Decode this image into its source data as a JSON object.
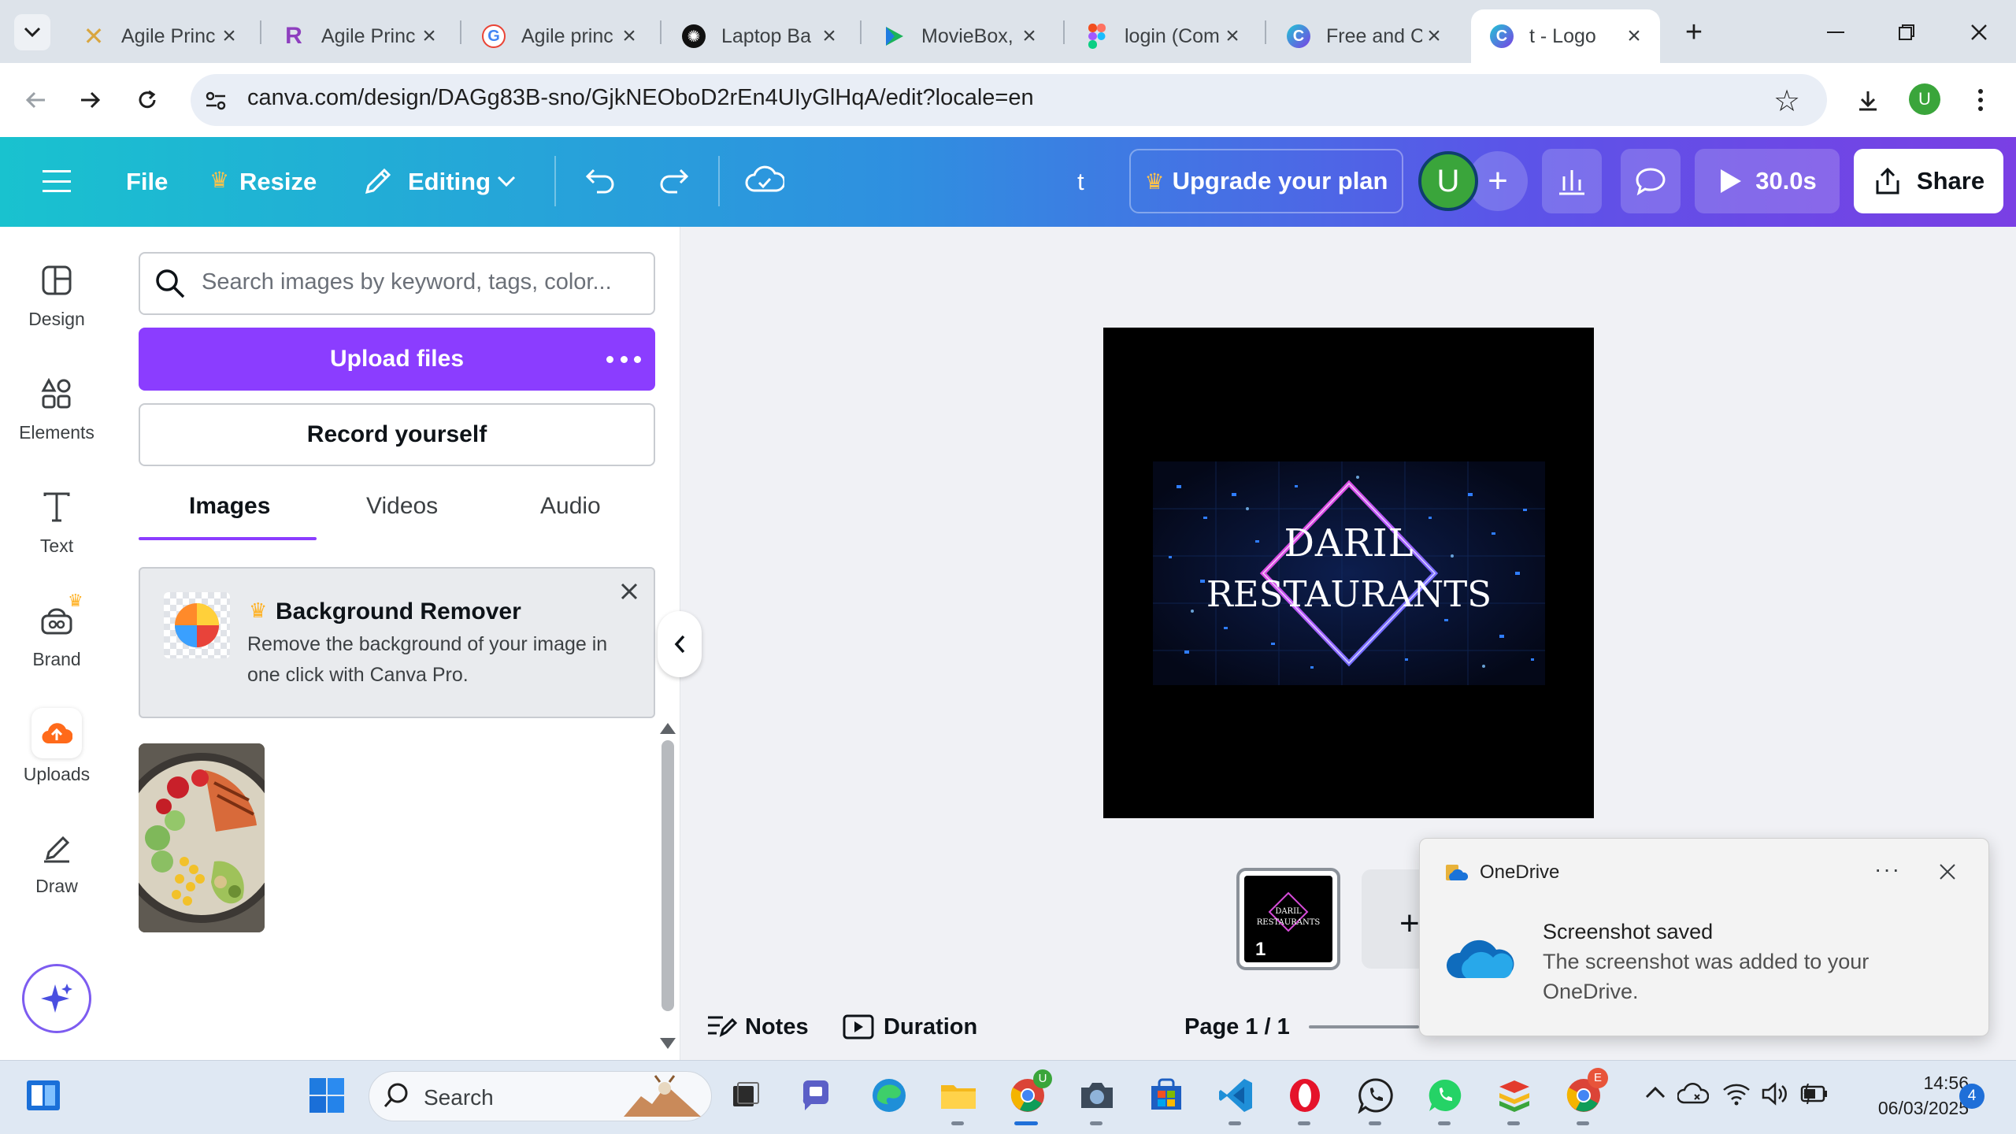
{
  "browser": {
    "tabs": [
      {
        "label": "Agile Princ",
        "icon": "agile-x-icon"
      },
      {
        "label": "Agile Princ",
        "icon": "agile-r-icon"
      },
      {
        "label": "Agile princ",
        "icon": "google-icon"
      },
      {
        "label": "Laptop Ba",
        "icon": "openai-icon"
      },
      {
        "label": "MovieBox,",
        "icon": "moviebox-icon"
      },
      {
        "label": "login (Com",
        "icon": "figma-icon"
      },
      {
        "label": "Free and C",
        "icon": "canva-icon"
      },
      {
        "label": "t - Logo",
        "icon": "canva-icon",
        "active": true
      }
    ],
    "url": "canva.com/design/DAGg83B-sno/GjkNEOboD2rEn4UIyGlHqA/edit?locale=en",
    "profile_initial": "U"
  },
  "header": {
    "file": "File",
    "resize": "Resize",
    "editing": "Editing",
    "design_title": "t",
    "upgrade": "Upgrade your plan",
    "avatar_initial": "U",
    "timer": "30.0s",
    "share": "Share"
  },
  "rail": [
    {
      "label": "Design",
      "icon": "design-icon"
    },
    {
      "label": "Elements",
      "icon": "elements-icon"
    },
    {
      "label": "Text",
      "icon": "text-icon"
    },
    {
      "label": "Brand",
      "icon": "brand-icon"
    },
    {
      "label": "Uploads",
      "icon": "uploads-icon",
      "active": true
    },
    {
      "label": "Draw",
      "icon": "draw-icon"
    }
  ],
  "panel": {
    "search_placeholder": "Search images by keyword, tags, color...",
    "upload_button": "Upload files",
    "record_button": "Record yourself",
    "tabs": [
      "Images",
      "Videos",
      "Audio"
    ],
    "promo_title": "Background Remover",
    "promo_text_line1": "Remove the background of your image in",
    "promo_text_line2": "one click with Canva Pro."
  },
  "design": {
    "logo_line1": "DARIL",
    "logo_line2": "RESTAURANTS",
    "page_number": "1"
  },
  "footer": {
    "notes": "Notes",
    "duration": "Duration",
    "page": "Page 1 / 1"
  },
  "toast": {
    "app": "OneDrive",
    "title": "Screenshot saved",
    "body_line1": "The screenshot was added to your",
    "body_line2": "OneDrive."
  },
  "taskbar": {
    "search": "Search",
    "time": "14:56",
    "date": "06/03/2025",
    "notification_count": "4",
    "chrome_badge": "U",
    "chrome2_badge": "E"
  },
  "colors": {
    "canva_purple": "#8b3dff",
    "header_gradient_start": "#19c2cf",
    "header_gradient_end": "#7a3fe4",
    "neon_pink": "#ff3cc8",
    "neon_blue": "#3a7bff"
  }
}
